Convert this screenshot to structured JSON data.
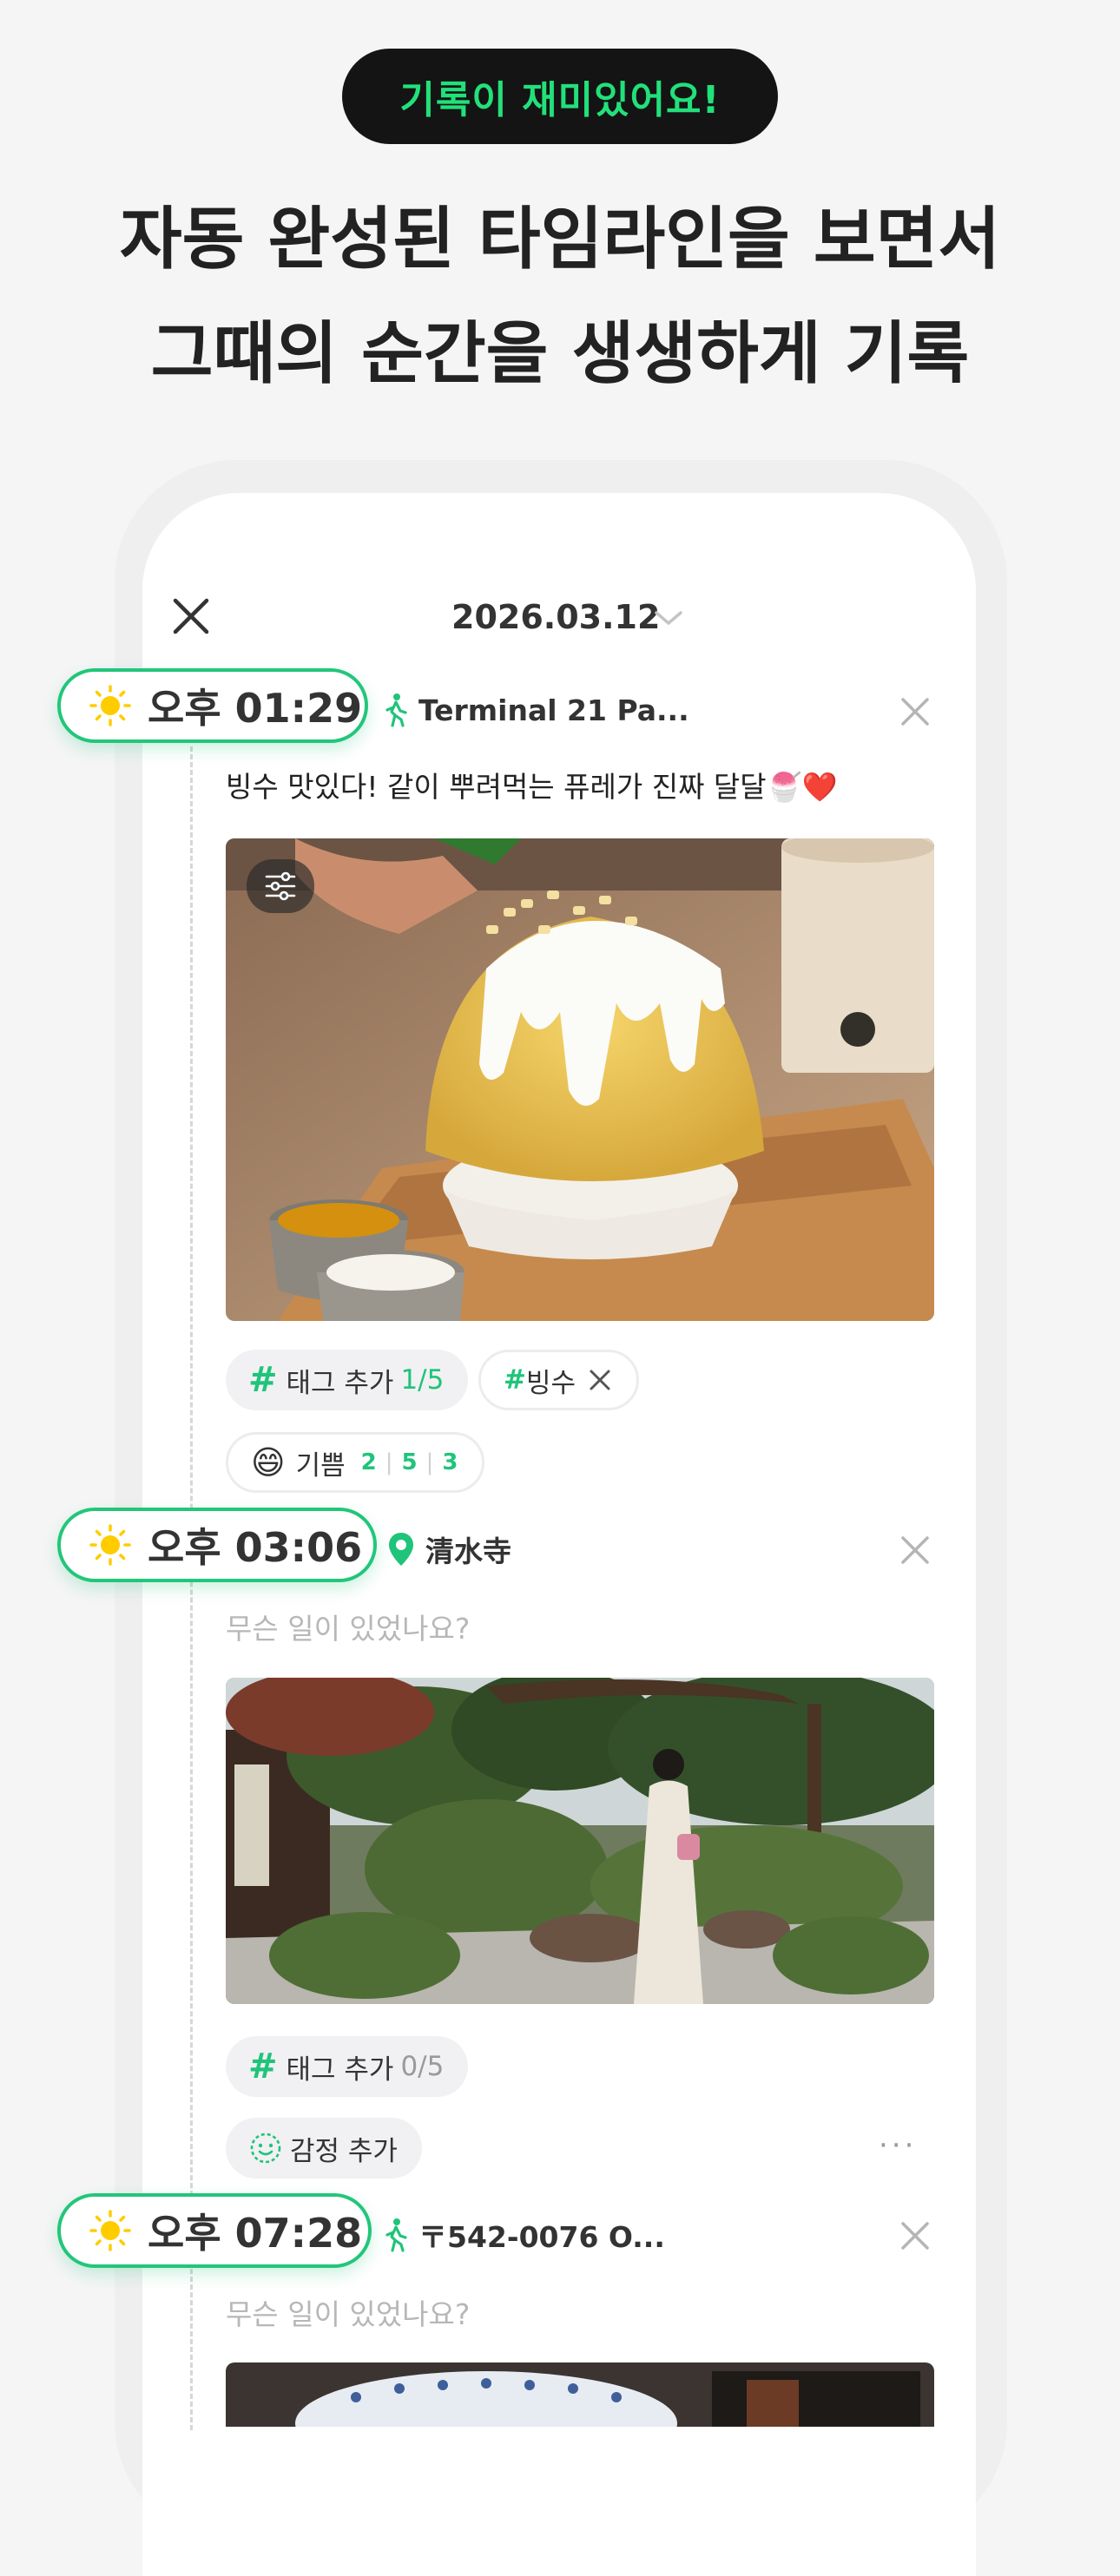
{
  "promo": {
    "badge": "기록이 재미있어요!",
    "headline_line1": "자동 완성된 타임라인을 보면서",
    "headline_line2": "그때의 순간을 생생하게 기록"
  },
  "header": {
    "date": "2026.03.12",
    "close_icon": "close-icon",
    "date_dropdown_icon": "chevron-down-icon"
  },
  "entries": [
    {
      "time": "오후 01:29",
      "weather_icon": "sun-icon",
      "location_icon": "walking-icon",
      "location": "Terminal 21 Pa...",
      "text": "빙수 맛있다! 같이 뿌려먹는 퓨레가 진짜 달달🍧❤️",
      "photo_desc_icon": "photo-shaved-ice",
      "tag_add_label": "태그 추가",
      "tag_count": "1/5",
      "tags": [
        "#빙수"
      ],
      "emotion_emoji": "😄",
      "emotion_label": "기쁨",
      "emotion_values": [
        "2",
        "5",
        "3"
      ]
    },
    {
      "time": "오후 03:06",
      "weather_icon": "sun-icon",
      "location_icon": "map-pin-icon",
      "location": "清水寺",
      "placeholder": "무슨 일이 있었나요?",
      "photo_desc_icon": "photo-garden-kimono",
      "tag_add_label": "태그 추가",
      "tag_count": "0/5",
      "emotion_add_label": "감정 추가",
      "more_label": "···"
    },
    {
      "time": "오후 07:28",
      "weather_icon": "sun-icon",
      "location_icon": "walking-icon",
      "location": "〒542-0076 O...",
      "placeholder": "무슨 일이 있었나요?"
    }
  ],
  "colors": {
    "accent_green": "#22c67a",
    "badge_bg": "#141414",
    "badge_text": "#22e07a",
    "sun": "#ffcc00"
  }
}
